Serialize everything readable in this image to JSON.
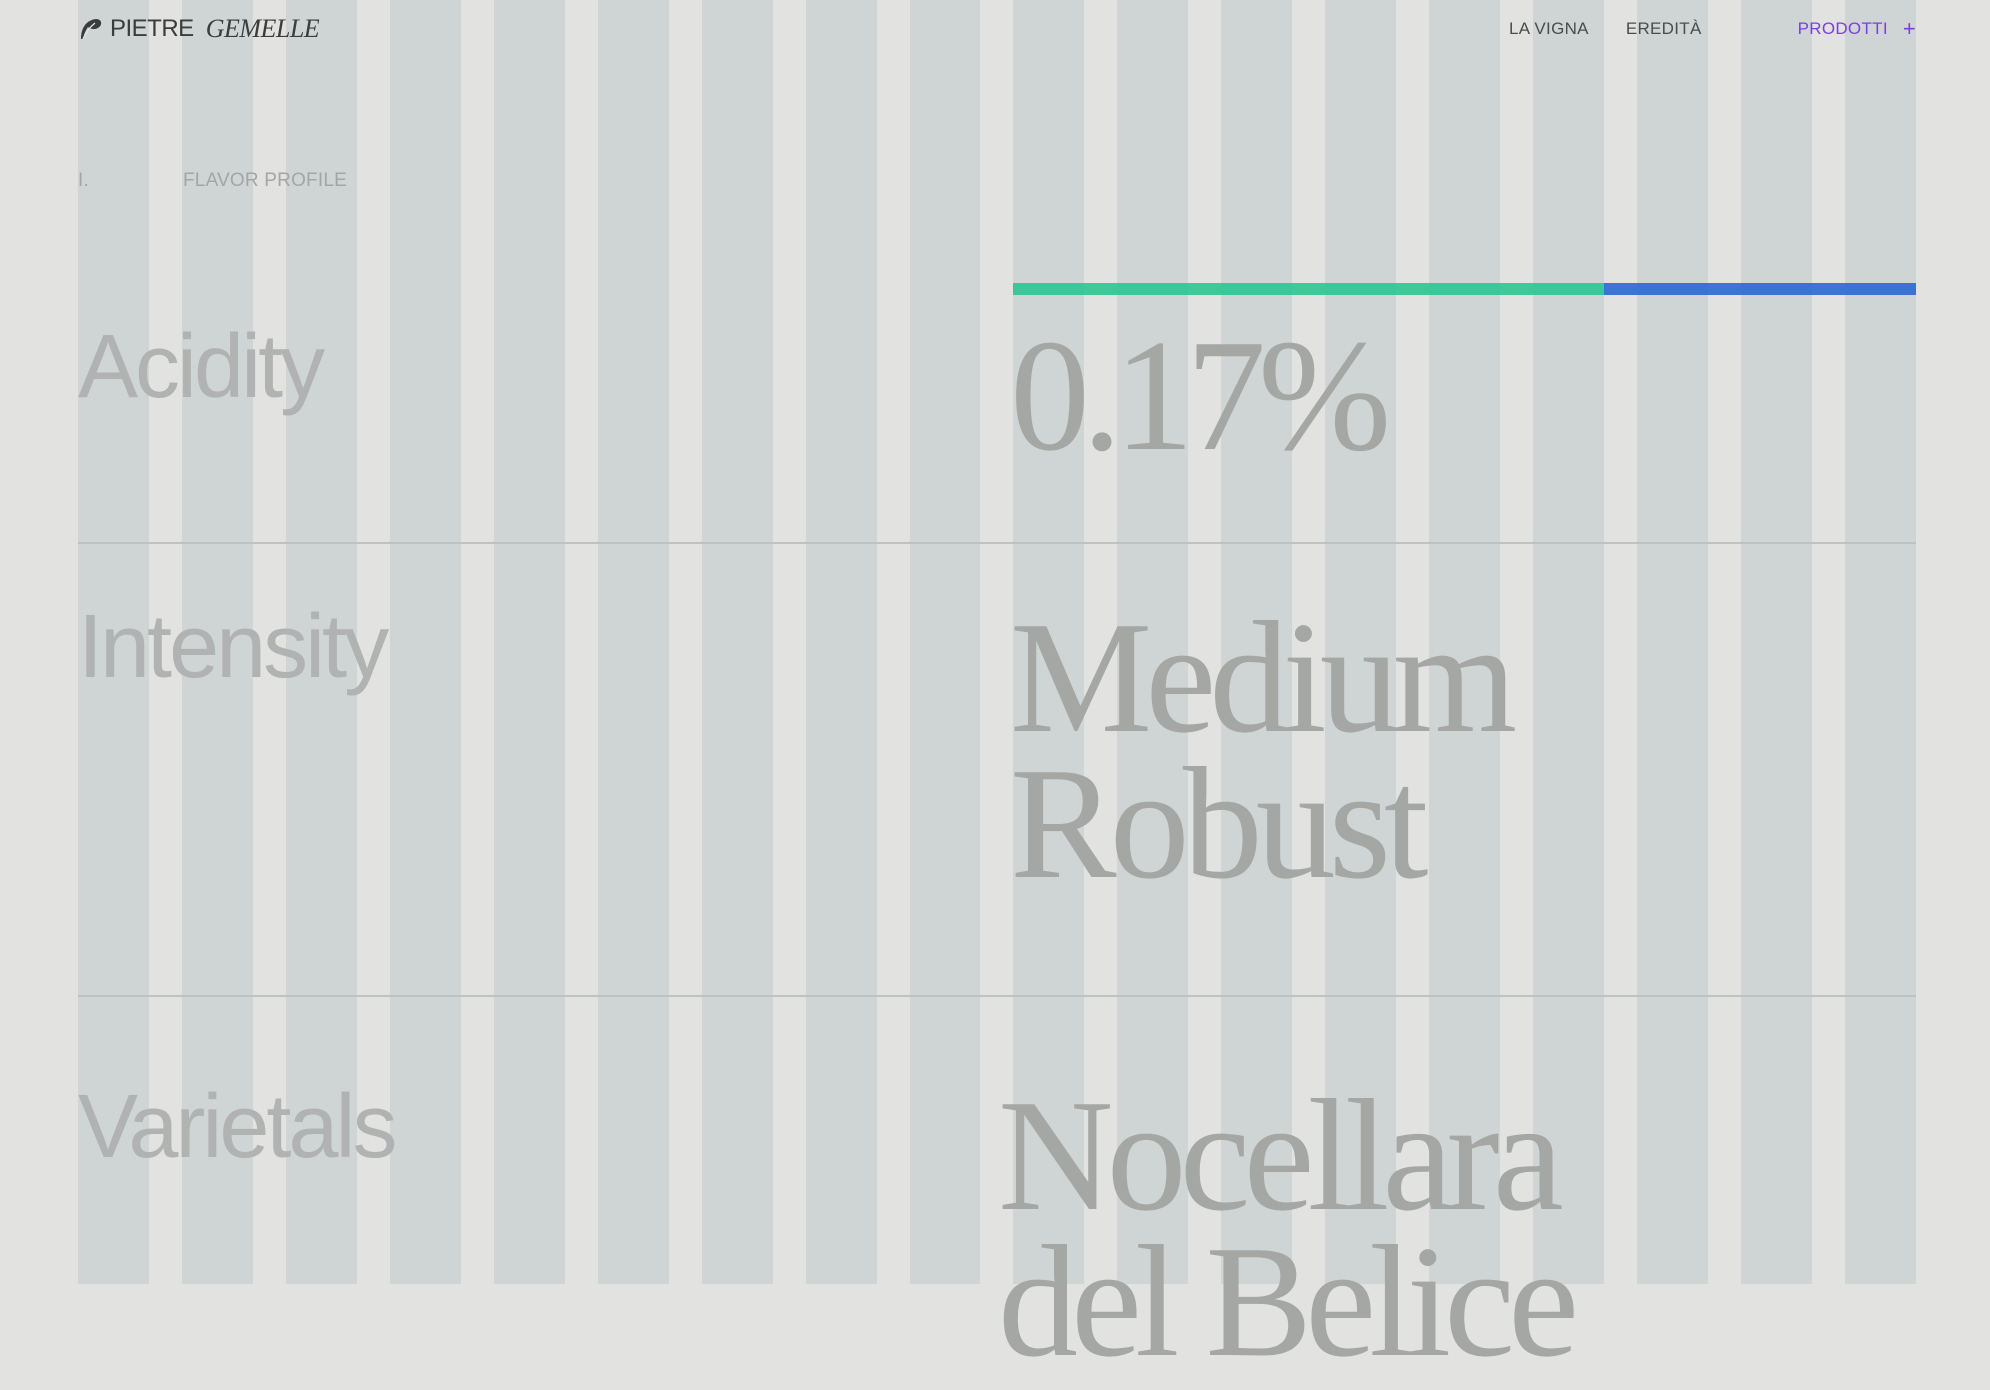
{
  "brand": {
    "name": "PIETRE",
    "name_italic": "GEMELLE"
  },
  "nav": {
    "links": [
      "LA VIGNA",
      "EREDITÀ"
    ],
    "products_label": "PRODOTTI",
    "products_icon": "+"
  },
  "section": {
    "number": "I.",
    "title": "FLAVOR PROFILE"
  },
  "profile": {
    "acidity": {
      "label": "Acidity",
      "value": "0.17%",
      "indicator_fraction": 0.655
    },
    "intensity": {
      "label": "Intensity",
      "value_lines": [
        "Medium",
        "Robust"
      ]
    },
    "varietals": {
      "label": "Varietals",
      "value_lines": [
        "Nocellara",
        "del Belice"
      ]
    }
  },
  "colors": {
    "background": "#e2e2e0",
    "grid_column": "#cfd4d4",
    "accent_purple": "#7a3fe3",
    "indicator_green": "#1ec58e",
    "indicator_blue": "#1f62d6"
  }
}
